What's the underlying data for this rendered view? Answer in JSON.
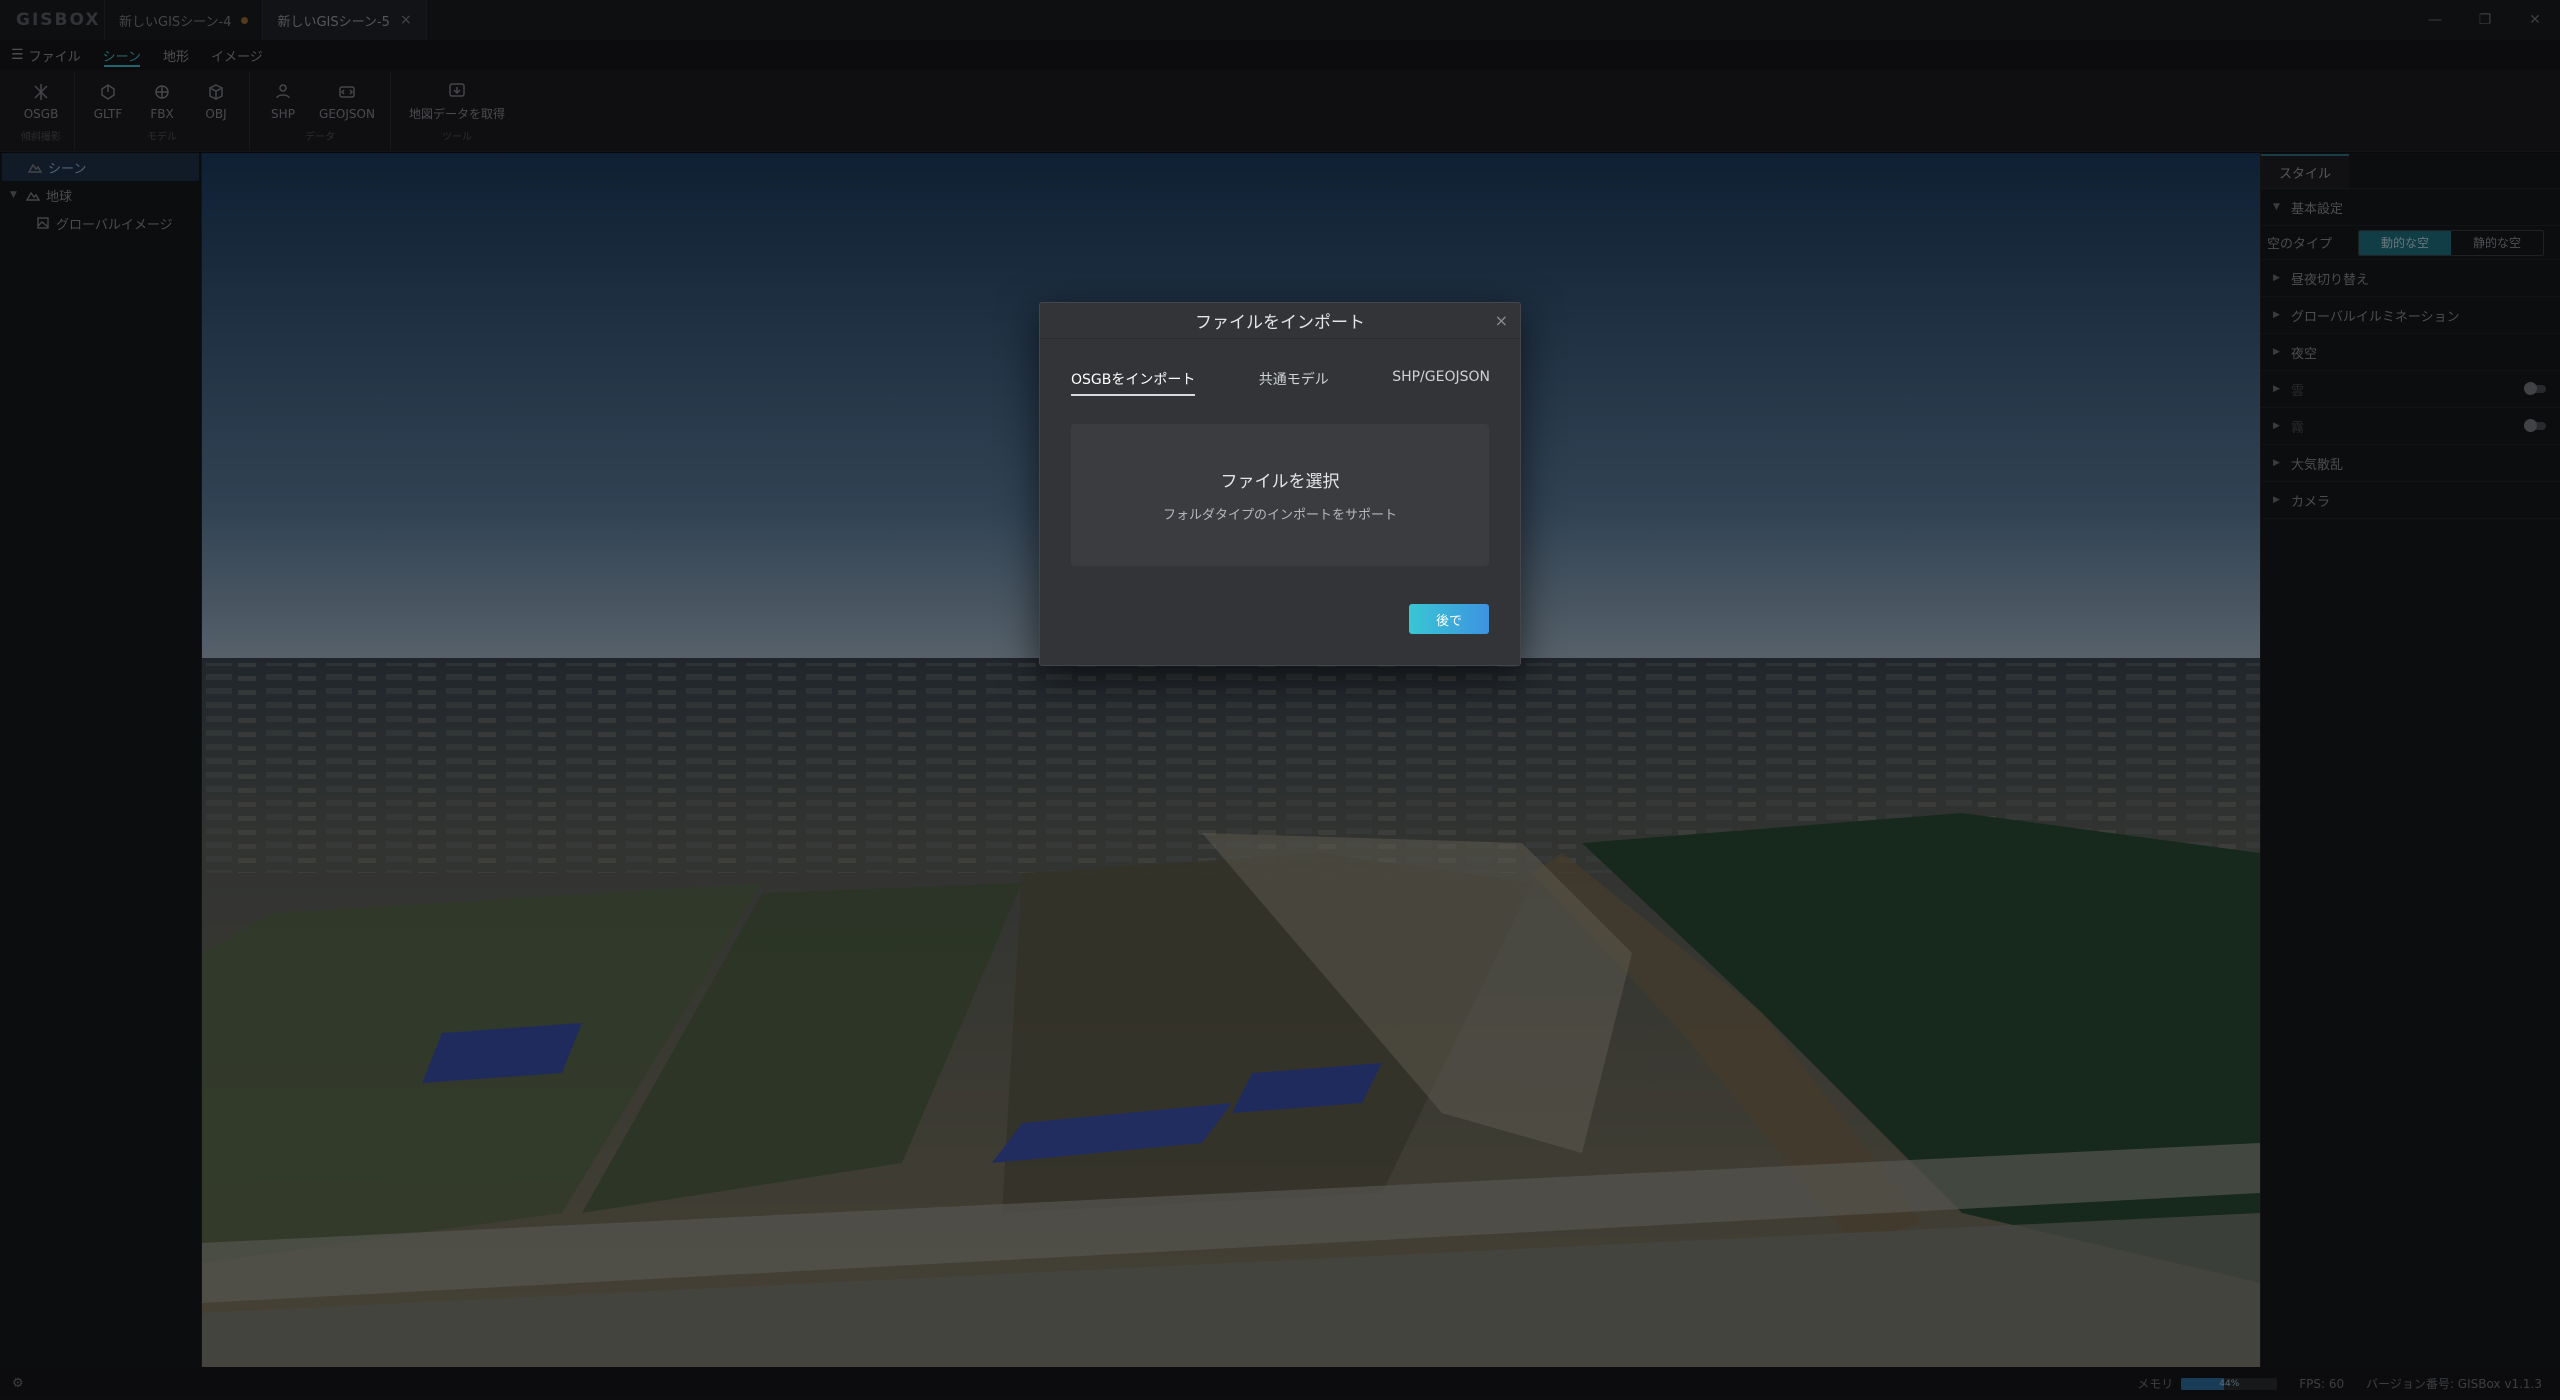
{
  "app": {
    "logo": "GISBOX"
  },
  "doc_tabs": [
    {
      "label": "新しいGISシーン-4",
      "modified": true
    },
    {
      "label": "新しいGISシーン-5",
      "close": "×"
    }
  ],
  "window_controls": {
    "minimize": "—",
    "restore": "❐",
    "close": "✕"
  },
  "menu": {
    "file": "ファイル",
    "items": [
      "シーン",
      "地形",
      "イメージ"
    ],
    "active": "シーン"
  },
  "ribbon": {
    "groups": [
      {
        "label": "傾斜撮影",
        "buttons": [
          "OSGB"
        ]
      },
      {
        "label": "モデル",
        "buttons": [
          "GLTF",
          "FBX",
          "OBJ"
        ]
      },
      {
        "label": "データ",
        "buttons": [
          "SHP",
          "GEOJSON"
        ]
      },
      {
        "label": "ツール",
        "buttons": [
          "地図データを取得"
        ]
      }
    ]
  },
  "tree": {
    "items": [
      {
        "label": "シーン",
        "icon": "scene-icon",
        "selected": true
      },
      {
        "label": "地球",
        "icon": "terrain-icon",
        "expanded": true
      },
      {
        "label": "グローバルイメージ",
        "icon": "image-layer-icon"
      }
    ]
  },
  "right_panel": {
    "tab": "スタイル",
    "basic": "基本設定",
    "sky_type_label": "空のタイプ",
    "sky_options": [
      "動的な空",
      "静的な空"
    ],
    "sky_selected": "動的な空",
    "sections": [
      {
        "label": "昼夜切り替え",
        "disabled": false
      },
      {
        "label": "グローバルイルミネーション",
        "disabled": false
      },
      {
        "label": "夜空",
        "disabled": false
      },
      {
        "label": "雲",
        "disabled": true,
        "toggle": true
      },
      {
        "label": "霧",
        "disabled": true,
        "toggle": true
      },
      {
        "label": "大気散乱",
        "disabled": false
      },
      {
        "label": "カメラ",
        "disabled": false
      }
    ]
  },
  "status": {
    "memory_label": "メモリ",
    "memory_percent": 44,
    "memory_text": "44%",
    "fps": "FPS: 60",
    "version": "バージョン番号: GISBox v1.1.3"
  },
  "modal": {
    "title": "ファイルをインポート",
    "close": "×",
    "tabs": [
      "OSGBをインポート",
      "共通モデル",
      "SHP/GEOJSON"
    ],
    "active_tab": "OSGBをインポート",
    "dropzone_title": "ファイルを選択",
    "dropzone_subtitle": "フォルダタイプのインポートをサポート",
    "later_button": "後で"
  }
}
